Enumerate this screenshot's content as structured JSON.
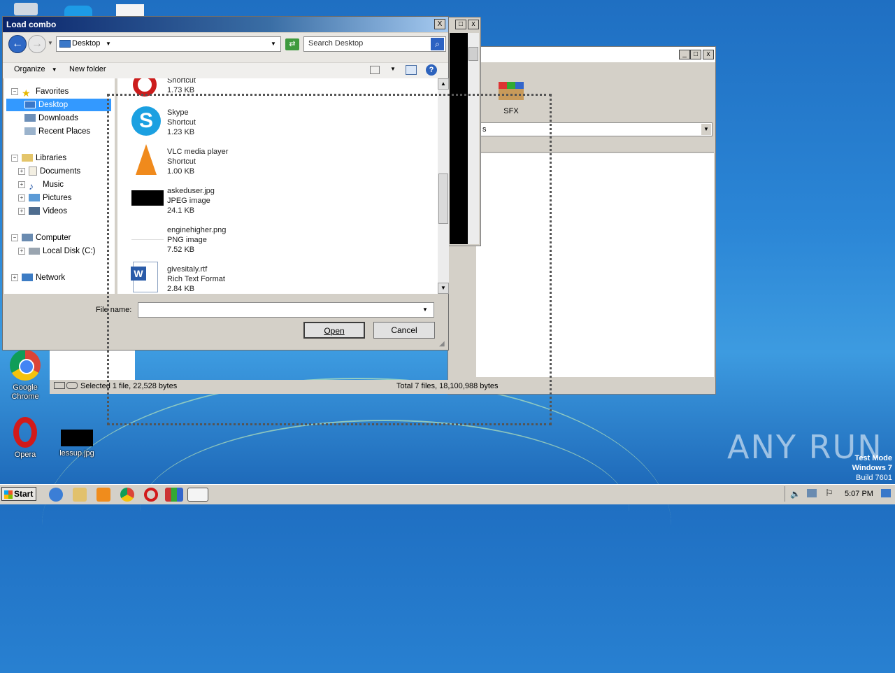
{
  "dialog": {
    "title": "Load combo",
    "close_label": "X",
    "address": "Desktop",
    "search_placeholder": "Search Desktop",
    "organize_label": "Organize",
    "new_folder_label": "New folder",
    "file_name_label": "File name:",
    "file_name_value": "",
    "open_label": "Open",
    "cancel_label": "Cancel"
  },
  "tree": {
    "favorites": "Favorites",
    "desktop": "Desktop",
    "downloads": "Downloads",
    "recent_places": "Recent Places",
    "libraries": "Libraries",
    "documents": "Documents",
    "music": "Music",
    "pictures": "Pictures",
    "videos": "Videos",
    "computer": "Computer",
    "local_disk": "Local Disk (C:)",
    "network": "Network"
  },
  "files": [
    {
      "name": "",
      "type": "Shortcut",
      "size": "1.73 KB"
    },
    {
      "name": "Skype",
      "type": "Shortcut",
      "size": "1.23 KB"
    },
    {
      "name": "VLC media player",
      "type": "Shortcut",
      "size": "1.00 KB"
    },
    {
      "name": "askeduser.jpg",
      "type": "JPEG image",
      "size": "24.1 KB"
    },
    {
      "name": "enginehigher.png",
      "type": "PNG image",
      "size": "7.52 KB"
    },
    {
      "name": "givesitaly.rtf",
      "type": "Rich Text Format",
      "size": "2.84 KB"
    }
  ],
  "winrar": {
    "sfx_label": "SFX",
    "path_fragment": "s",
    "status_selected": "Selected 1 file, 22,528 bytes",
    "status_total": "Total 7 files, 18,100,988 bytes"
  },
  "desktop_icons": {
    "chrome": "Google Chrome",
    "opera": "Opera",
    "lessup": "lessup.jpg"
  },
  "watermark": {
    "test_mode": "Test Mode",
    "windows": "Windows 7",
    "build": "Build 7601",
    "anyrun": "ANY RUN"
  },
  "taskbar": {
    "start_label": "Start",
    "clock": "5:07 PM"
  }
}
